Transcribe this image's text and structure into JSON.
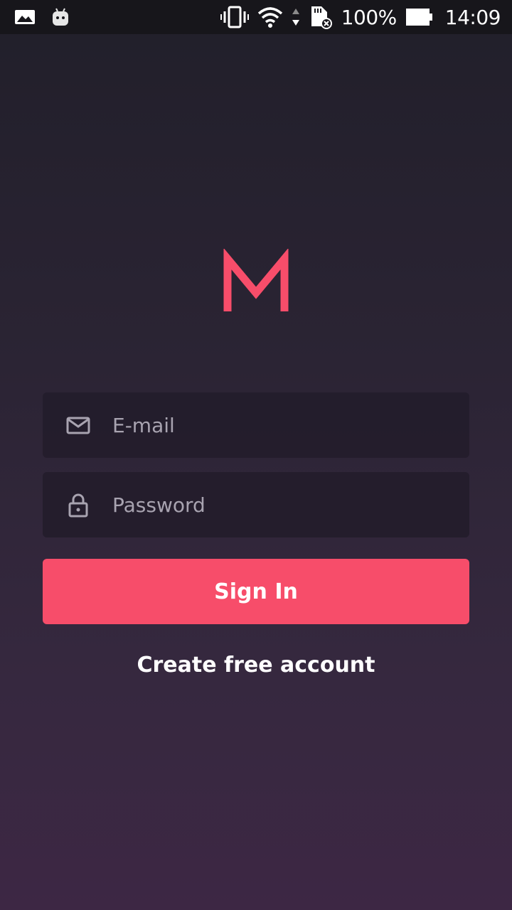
{
  "status_bar": {
    "battery_percent": "100%",
    "time": "14:09",
    "icons": [
      "image-notification-icon",
      "android-notification-icon",
      "vibrate-icon",
      "wifi-icon",
      "data-arrows-icon",
      "sd-card-error-icon",
      "battery-icon"
    ]
  },
  "brand": {
    "logo_letter": "M",
    "accent_color": "#f74d6a"
  },
  "form": {
    "email_placeholder": "E-mail",
    "email_value": "",
    "password_placeholder": "Password",
    "password_value": "",
    "signin_label": "Sign In",
    "create_account_label": "Create free account"
  }
}
